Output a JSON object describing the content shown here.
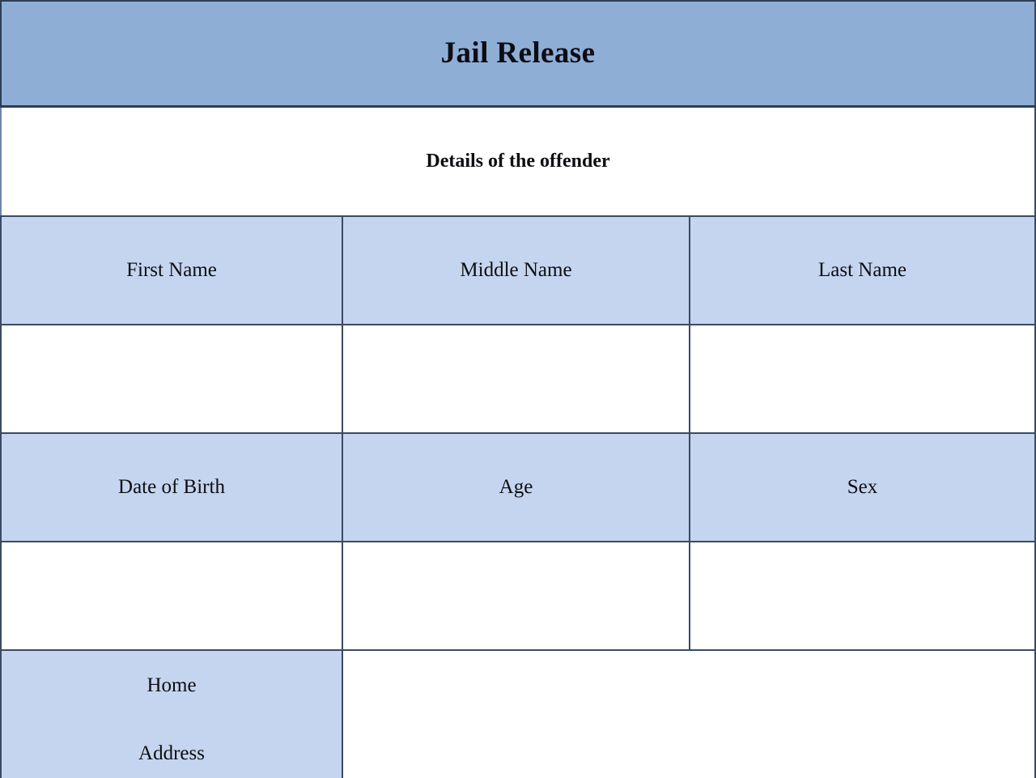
{
  "form": {
    "title": "Jail Release",
    "section_heading": "Details of the offender",
    "colors": {
      "banner_background": "#8eaed6",
      "label_background": "#c5d5ef",
      "value_background": "#ffffff",
      "border": "#3a4a63",
      "text": "#0d0d12"
    },
    "rows": [
      {
        "kind": "labels",
        "cells": [
          {
            "label": "First Name"
          },
          {
            "label": "Middle Name"
          },
          {
            "label": "Last Name"
          }
        ]
      },
      {
        "kind": "values",
        "cells": [
          {
            "value": ""
          },
          {
            "value": ""
          },
          {
            "value": ""
          }
        ]
      },
      {
        "kind": "labels",
        "cells": [
          {
            "label": "Date of Birth"
          },
          {
            "label": "Age"
          },
          {
            "label": "Sex"
          }
        ]
      },
      {
        "kind": "values",
        "cells": [
          {
            "value": ""
          },
          {
            "value": ""
          },
          {
            "value": ""
          }
        ]
      },
      {
        "kind": "address",
        "label_line_1": "Home",
        "label_line_2": "Address",
        "value": ""
      }
    ]
  }
}
